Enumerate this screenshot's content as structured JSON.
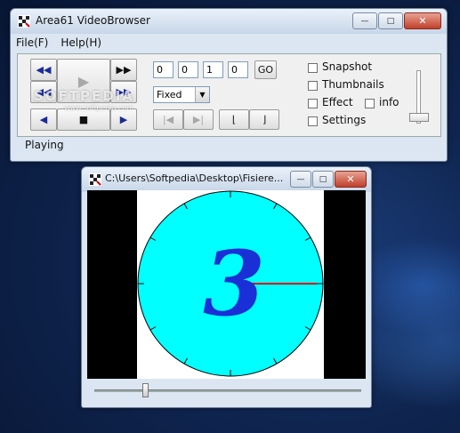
{
  "main_window": {
    "title": "Area61 VideoBrowser",
    "menu": [
      "File(F)",
      "Help(H)"
    ],
    "position_fields": [
      "0",
      "0",
      "1",
      "0"
    ],
    "go_label": "GO",
    "mode_select": "Fixed",
    "status": "Playing",
    "options": [
      {
        "label": "Snapshot",
        "checked": false
      },
      {
        "label": "Thumbnails",
        "checked": false
      },
      {
        "label": "Effect",
        "checked": false
      },
      {
        "label": "info",
        "checked": false
      },
      {
        "label": "Settings",
        "checked": false
      }
    ],
    "watermark": "SOFTPEDIA",
    "watermark_sub": "www.softpedia.com"
  },
  "video_window": {
    "title": "C:\\Users\\Softpedia\\Desktop\\Fisiere...",
    "frame_number": "3",
    "seek_position": 0.18
  },
  "icons": {
    "rewind": "◀◀",
    "play": "▶",
    "fast_forward": "▶▶",
    "step_back": "◀",
    "stop": "■",
    "step_forward": "▶",
    "skip_start": "|◀",
    "skip_end": "▶|",
    "mark_in": "⌊",
    "mark_out": "⌋"
  },
  "colors": {
    "clock_face": "#00ffff",
    "digit": "#1a2fd6",
    "hand": "#e00000"
  }
}
